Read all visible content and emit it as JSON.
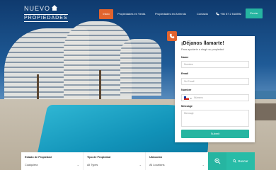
{
  "logo": {
    "line1": "NUEVO",
    "line2": "PROPIEDADES"
  },
  "nav": {
    "items": [
      "Inicio",
      "Propiedades en Venta",
      "Propiedades en Arriendo",
      "Contacto"
    ],
    "phone": "+56 57 2 518592",
    "send_label": "Enviar"
  },
  "contact_form": {
    "title": "¡Déjanos llamarte!",
    "subtitle": "Para ayudarte a elegir su propiedad",
    "name_label": "Name",
    "name_placeholder": "Nombre",
    "email_label": "Email",
    "email_placeholder": "Su Email",
    "number_label": "Number",
    "number_placeholder": "Número",
    "message_label": "Message",
    "message_placeholder": "Mensaje",
    "submit_label": "Submit"
  },
  "search": {
    "fields": [
      {
        "label": "Estado de Propiedad",
        "value": "Cualquiera"
      },
      {
        "label": "Tipo de Propiedad",
        "value": "All Types"
      },
      {
        "label": "Ubicación",
        "value": "All Locations"
      }
    ],
    "button_label": "Buscar"
  },
  "colors": {
    "accent": "#e2642e",
    "teal": "#26b5a1"
  }
}
